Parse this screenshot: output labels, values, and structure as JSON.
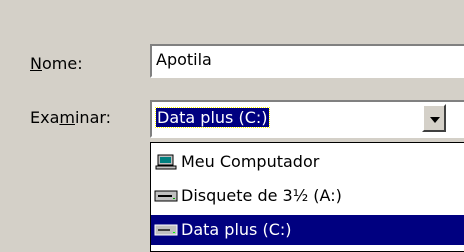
{
  "name_label": {
    "prefix": "",
    "mnemonic": "N",
    "suffix": "ome:"
  },
  "name_value": "Apotila",
  "examine_label": {
    "prefix": "Exa",
    "mnemonic": "m",
    "suffix": "inar:"
  },
  "examine_value": "Data plus (C:)",
  "dropdown_items": [
    {
      "label": "Meu Computador",
      "icon": "computer-icon"
    },
    {
      "label": "Disquete de 3½ (A:)",
      "icon": "floppy-drive-icon"
    },
    {
      "label": "Data plus (C:)",
      "icon": "hard-drive-icon",
      "selected": true
    }
  ]
}
